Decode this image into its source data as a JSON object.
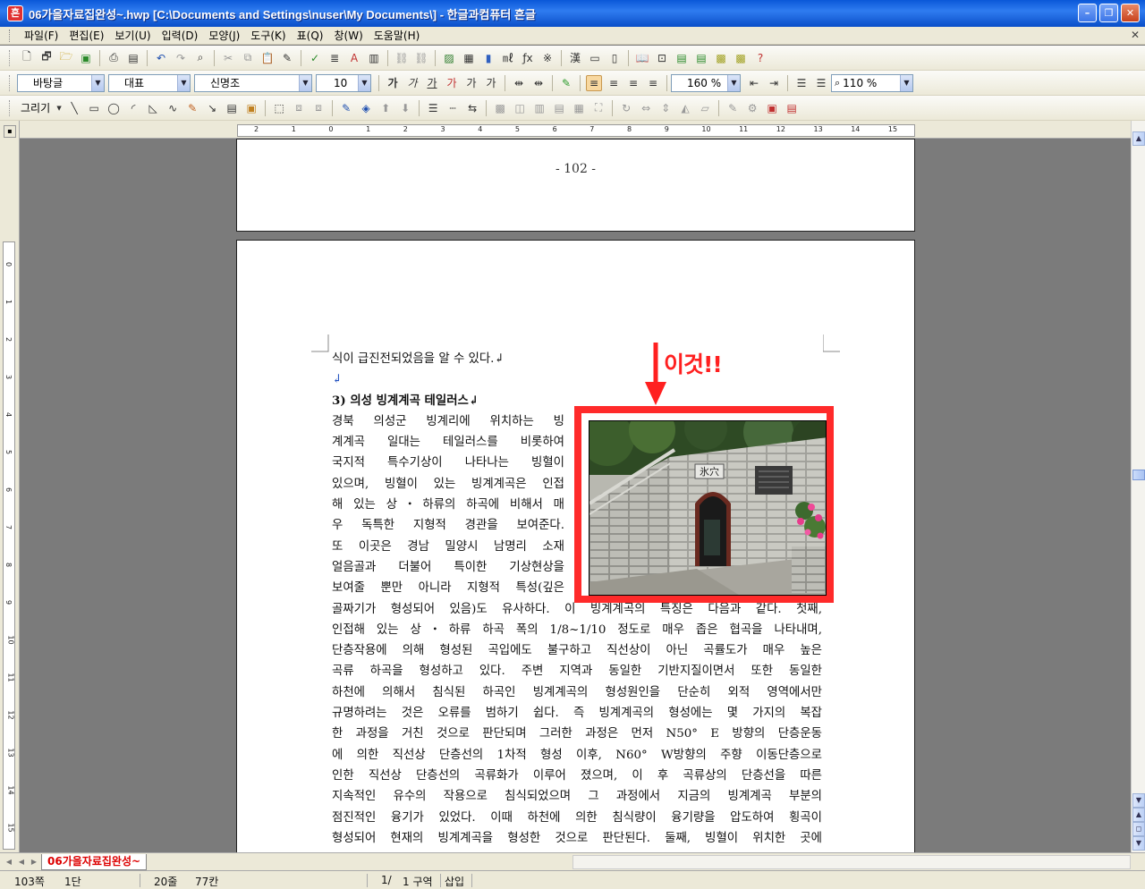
{
  "window": {
    "title": "06가을자료집완성~.hwp [C:\\Documents and Settings\\nuser\\My Documents\\] - 한글과컴퓨터 흔글",
    "minimize": "–",
    "maximize": "❐",
    "close": "✕"
  },
  "menu": {
    "items": [
      "파일(F)",
      "편집(E)",
      "보기(U)",
      "입력(D)",
      "모양(J)",
      "도구(K)",
      "표(Q)",
      "창(W)",
      "도움말(H)"
    ],
    "close": "✕"
  },
  "format_toolbar": {
    "style": "바탕글",
    "lang": "대표",
    "font": "신명조",
    "size": "10",
    "line_spacing": "160 %",
    "zoom": "110 %",
    "bold": "가",
    "italic": "가",
    "underline": "가"
  },
  "draw_toolbar": {
    "label": "그리기"
  },
  "document": {
    "page_number": "- 102 -",
    "lines": [
      "식이 급진전되었음을 알 수 있다.↲",
      "↲",
      "3) 의성 빙계계곡 테일러스↲",
      "    경북 의성군 빙계리에 위치하는 빙",
      "계계곡 일대는 테일러스를 비롯하여",
      "국지적 특수기상이 나타나는 빙혈이",
      "있으며, 빙혈이 있는 빙계계곡은 인접",
      "해 있는 상・하류의 하곡에 비해서 매",
      "우 독특한 지형적 경관을 보여준다.",
      "또 이곳은 경남 밀양시 남명리 소재",
      "얼음골과 더불어 특이한 기상현상을",
      "보여줄 뿐만 아니라 지형적 특성(깊은",
      "골짜기가 형성되어 있음)도 유사하다. 이 빙계계곡의 특징은 다음과 같다. 첫째,",
      "인접해 있는 상・하류 하곡 폭의 1/8~1/10 정도로 매우 좁은 협곡을 나타내며,",
      "단층작용에 의해 형성된 곡입에도 불구하고 직선상이 아닌 곡률도가 매우 높은",
      "곡류 하곡을 형성하고 있다. 주변 지역과 동일한 기반지질이면서 또한 동일한",
      "하천에 의해서 침식된 하곡인 빙계계곡의 형성원인을 단순히 외적 영역에서만",
      "규명하려는 것은 오류를 범하기 쉽다. 즉 빙계계곡의 형성에는 몇 가지의 복잡",
      "한 과정을 거친 것으로 판단되며 그러한 과정은 먼저 N50° E 방향의 단층운동",
      "에 의한 직선상 단층선의 1차적 형성 이후, N60° W방향의 주향 이동단층으로",
      "인한 직선상 단층선의 곡류화가 이루어 졌으며, 이 후 곡류상의 단층선을 따른",
      "지속적인 유수의 작용으로 침식되었으며 그 과정에서 지금의 빙계계곡 부분의",
      "점진적인 융기가 있었다. 이때 하천에 의한 침식량이 융기량을 압도하여 횡곡이",
      "형성되어 현재의 빙계계곡을 형성한 것으로 판단된다. 둘째, 빙혈이 위치한 곳에"
    ]
  },
  "annotation": {
    "text": "이것!!",
    "arrow_color": "#ff2020",
    "frame_color": "#ff2a2a"
  },
  "photo": {
    "sign_text": "氷穴"
  },
  "tabs": {
    "active": "06가을자료집완성~"
  },
  "status": {
    "page": "103쪽",
    "column": "1단",
    "line": "20줄",
    "col": "77칸",
    "section_page": "1/",
    "section": "1 구역",
    "mode": "삽입"
  }
}
